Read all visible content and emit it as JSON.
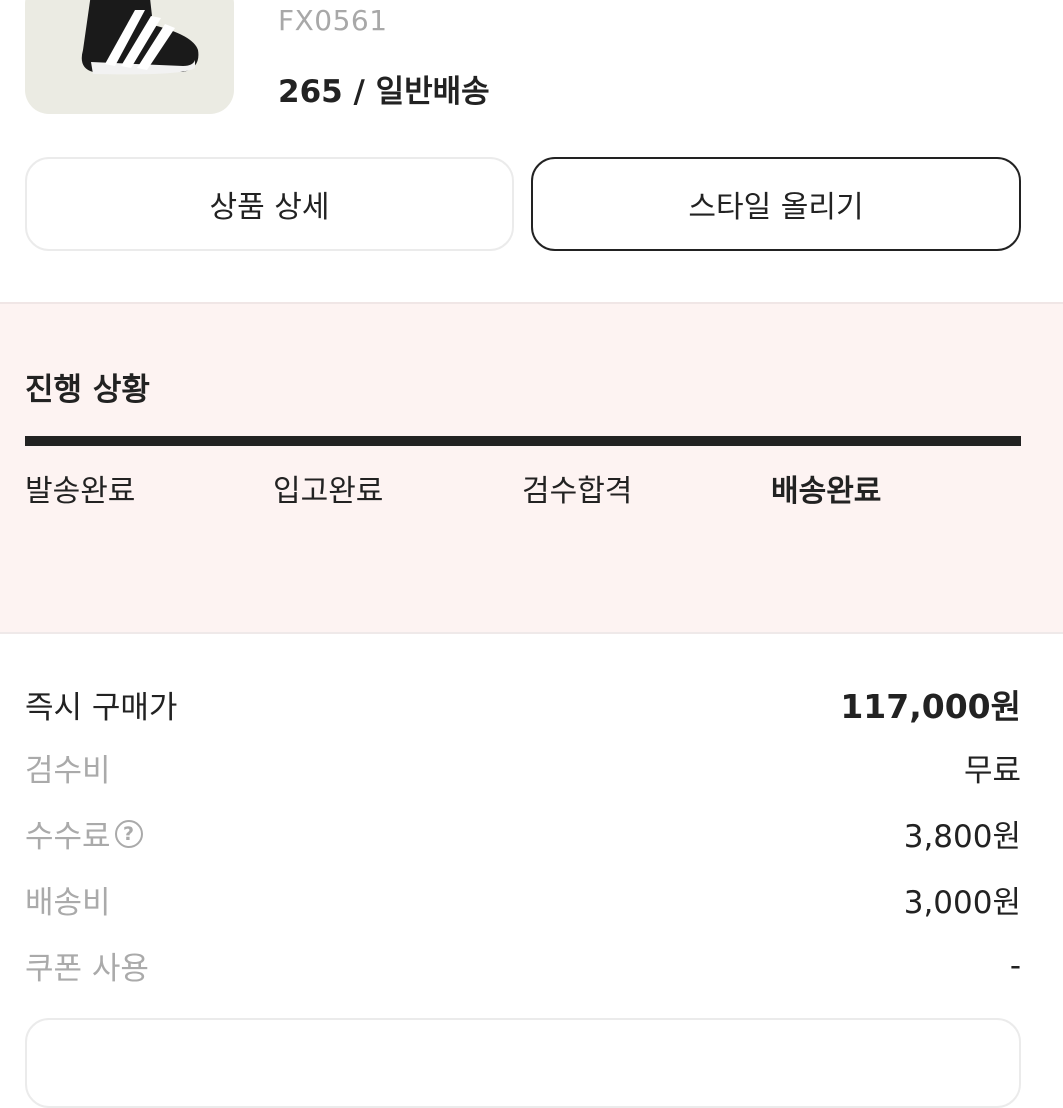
{
  "product": {
    "model_code": "FX0561",
    "option": "265 / 일반배송"
  },
  "actions": {
    "detail_label": "상품 상세",
    "style_label": "스타일 올리기"
  },
  "status": {
    "title": "진행 상황",
    "steps": [
      "발송완료",
      "입고완료",
      "검수합격",
      "배송완료"
    ],
    "current_step": "배송완료"
  },
  "price": {
    "buy_now_label": "즉시 구매가",
    "buy_now_value": "117,000원",
    "inspection_label": "검수비",
    "inspection_value": "무료",
    "fee_label": "수수료",
    "fee_value": "3,800원",
    "shipping_label": "배송비",
    "shipping_value": "3,000원",
    "coupon_label": "쿠폰 사용",
    "coupon_value": "-"
  },
  "colors": {
    "status_bg": "#fdf3f2",
    "text": "#222222",
    "muted": "#aaaaaa"
  }
}
